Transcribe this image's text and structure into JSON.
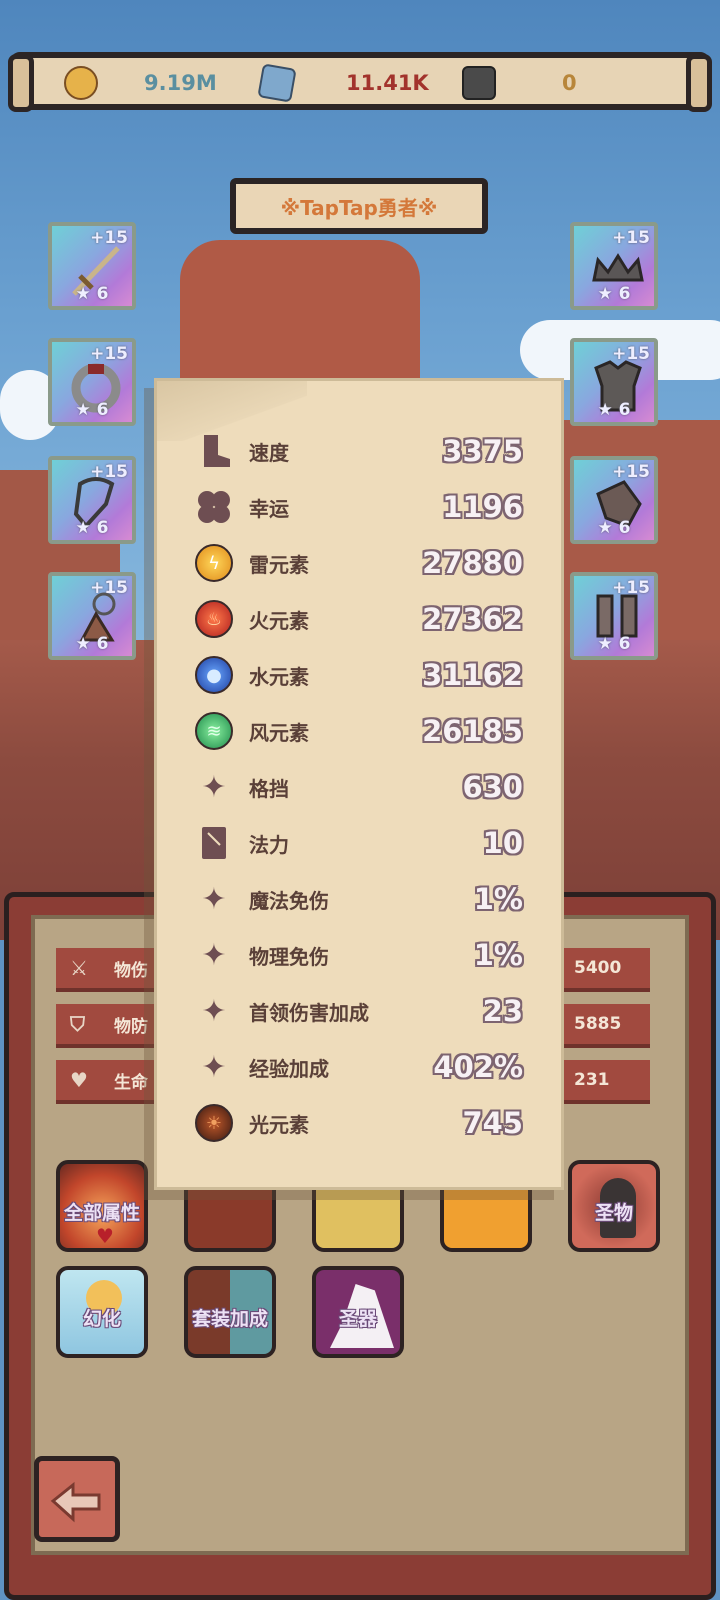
{
  "resources": [
    {
      "icon": "gold-coin-icon",
      "value": "9.19M",
      "color": "#5a8fa0"
    },
    {
      "icon": "blue-gem-icon",
      "value": "11.41K",
      "color": "#a2332c"
    },
    {
      "icon": "dark-rune-icon",
      "value": "0",
      "color": "#b8863a"
    }
  ],
  "banner": {
    "title": "※TapTap勇者※"
  },
  "equipment": {
    "left": [
      {
        "name": "sword",
        "level": "+15",
        "stars": "★ 6"
      },
      {
        "name": "ring",
        "level": "+15",
        "stars": "★ 6"
      },
      {
        "name": "necklace",
        "level": "+15",
        "stars": "★ 6"
      },
      {
        "name": "amulet",
        "level": "+15",
        "stars": "★ 6"
      }
    ],
    "right": [
      {
        "name": "crown",
        "level": "+15",
        "stars": "★ 6"
      },
      {
        "name": "armor",
        "level": "+15",
        "stars": "★ 6"
      },
      {
        "name": "gauntlet",
        "level": "+15",
        "stars": "★ 6"
      },
      {
        "name": "boots",
        "level": "+15",
        "stars": "★ 6"
      }
    ]
  },
  "stats_popup": {
    "rows": [
      {
        "icon": "boot-icon",
        "label": "速度",
        "value": "3375"
      },
      {
        "icon": "clover-icon",
        "label": "幸运",
        "value": "1196"
      },
      {
        "icon": "thunder-element-icon",
        "label": "雷元素",
        "value": "27880"
      },
      {
        "icon": "fire-element-icon",
        "label": "火元素",
        "value": "27362"
      },
      {
        "icon": "water-element-icon",
        "label": "水元素",
        "value": "31162"
      },
      {
        "icon": "wind-element-icon",
        "label": "风元素",
        "value": "26185"
      },
      {
        "icon": "sparkle-icon",
        "label": "格挡",
        "value": "630"
      },
      {
        "icon": "spellbook-icon",
        "label": "法力",
        "value": "10"
      },
      {
        "icon": "sparkle-icon",
        "label": "魔法免伤",
        "value": "1%"
      },
      {
        "icon": "sparkle-icon",
        "label": "物理免伤",
        "value": "1%"
      },
      {
        "icon": "sparkle-icon",
        "label": "首领伤害加成",
        "value": "23"
      },
      {
        "icon": "sparkle-icon",
        "label": "经验加成",
        "value": "402%"
      },
      {
        "icon": "light-element-icon",
        "label": "光元素",
        "value": "745"
      }
    ]
  },
  "base_stats": [
    {
      "icon": "sword-icon",
      "label": "物伤",
      "value": "5400"
    },
    {
      "icon": "shield-icon",
      "label": "物防",
      "value": "5885"
    },
    {
      "icon": "heart-icon",
      "label": "生命",
      "value": "231"
    }
  ],
  "menu_buttons": [
    {
      "name": "all-attributes",
      "label": "全部属性"
    },
    {
      "name": "holy-object",
      "label": "圣物"
    },
    {
      "name": "transform",
      "label": "幻化"
    },
    {
      "name": "set-bonus",
      "label": "套装加成"
    },
    {
      "name": "holy-artifact",
      "label": "圣器"
    }
  ]
}
